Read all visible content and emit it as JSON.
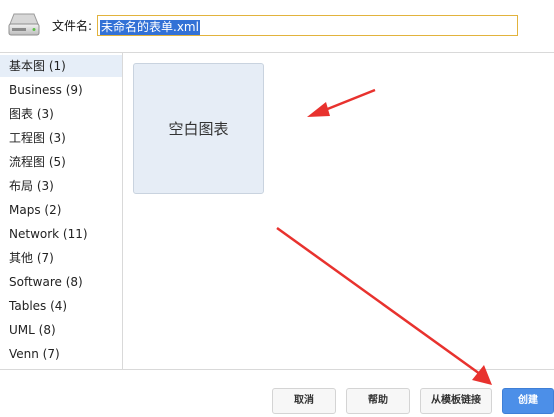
{
  "header": {
    "filename_label": "文件名:",
    "filename_value": "未命名的表单.xml",
    "drive_icon": "hard-drive-icon"
  },
  "sidebar": {
    "items": [
      {
        "label": "基本图 (1)",
        "selected": true
      },
      {
        "label": "Business (9)",
        "selected": false
      },
      {
        "label": "图表 (3)",
        "selected": false
      },
      {
        "label": "工程图 (3)",
        "selected": false
      },
      {
        "label": "流程图 (5)",
        "selected": false
      },
      {
        "label": "布局 (3)",
        "selected": false
      },
      {
        "label": "Maps (2)",
        "selected": false
      },
      {
        "label": "Network (11)",
        "selected": false
      },
      {
        "label": "其他 (7)",
        "selected": false
      },
      {
        "label": "Software (8)",
        "selected": false
      },
      {
        "label": "Tables (4)",
        "selected": false
      },
      {
        "label": "UML (8)",
        "selected": false
      },
      {
        "label": "Venn (7)",
        "selected": false
      }
    ]
  },
  "templates": [
    {
      "title": "空白图表"
    }
  ],
  "footer": {
    "cancel_label": "取消",
    "help_label": "帮助",
    "from_template_link_label": "从模板链接",
    "create_label": "创建"
  },
  "colors": {
    "accent": "#4c8fe8",
    "selection": "#3271d6",
    "input_border": "#e2b33d",
    "annotation_red": "#e8322e",
    "selected_item_bg": "#e6eef8",
    "card_bg": "#e6edf6"
  }
}
